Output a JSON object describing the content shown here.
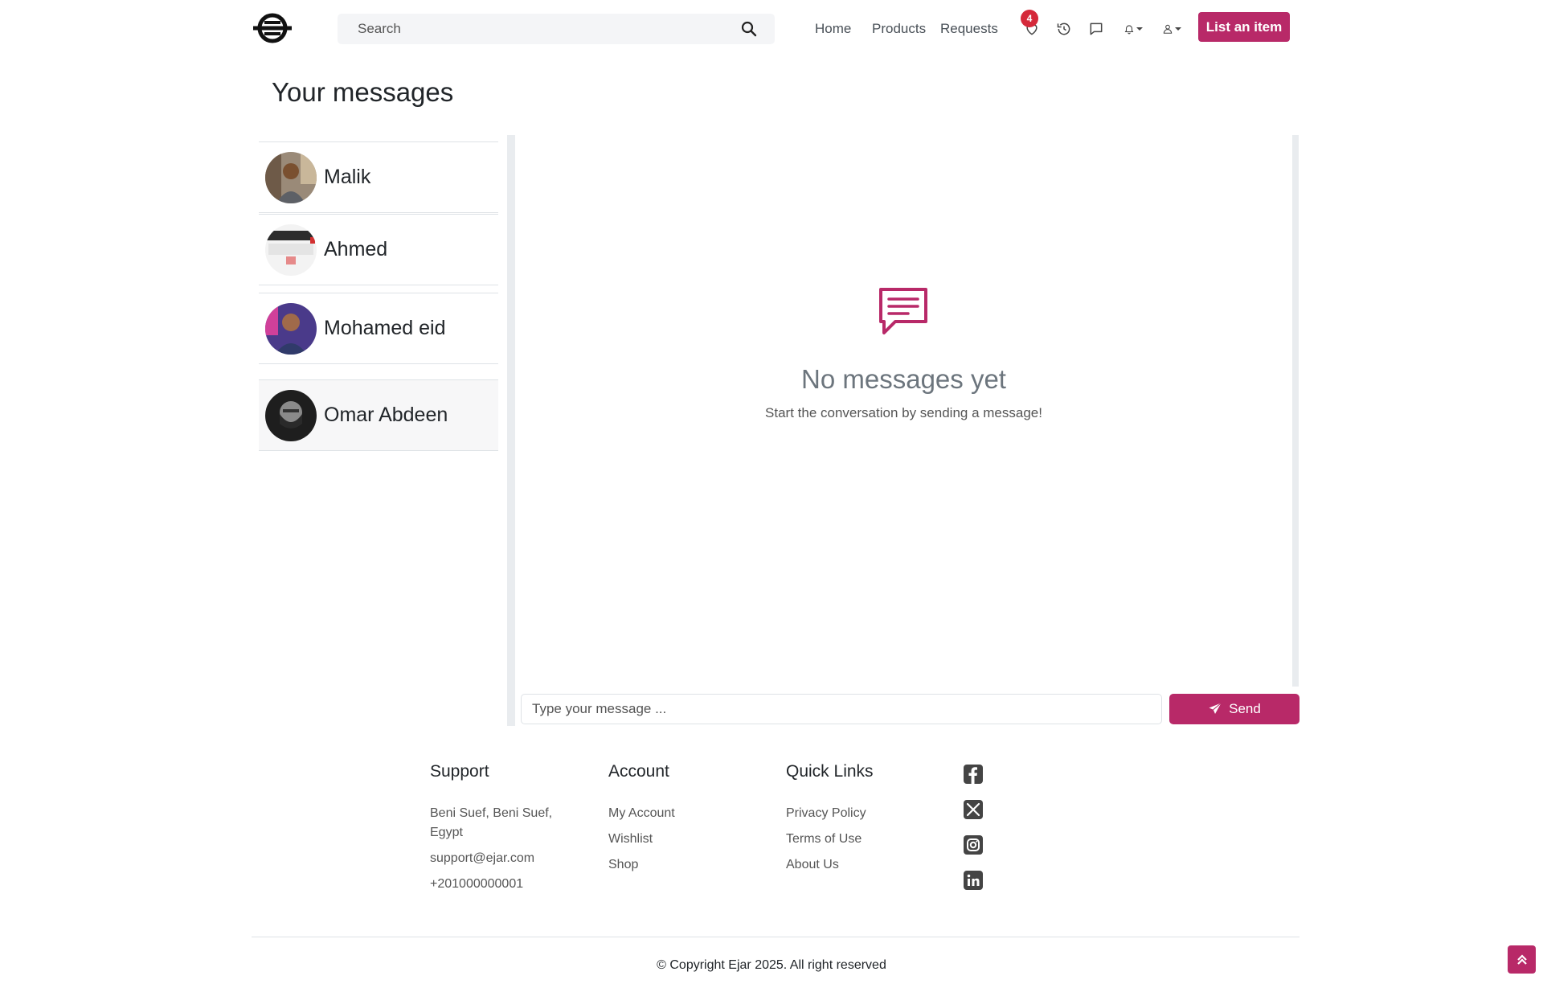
{
  "navbar": {
    "search_placeholder": "Search",
    "links": {
      "home": "Home",
      "products": "Products",
      "requests": "Requests"
    },
    "wishlist_count": "4",
    "list_item_label": "List an item"
  },
  "page": {
    "title": "Your messages"
  },
  "chats": [
    {
      "name": "Malik"
    },
    {
      "name": "Ahmed"
    },
    {
      "name": "Mohamed eid"
    },
    {
      "name": "Omar Abdeen"
    }
  ],
  "chat_panel": {
    "empty_title": "No messages yet",
    "empty_subtitle": "Start the conversation by sending a message!",
    "input_placeholder": "Type your message ...",
    "send_label": "Send"
  },
  "footer": {
    "support": {
      "heading": "Support",
      "address": "Beni Suef, Beni Suef, Egypt",
      "email": "support@ejar.com",
      "phone": "+201000000001"
    },
    "account": {
      "heading": "Account",
      "links": [
        "My Account",
        "Wishlist",
        "Shop"
      ]
    },
    "quick_links": {
      "heading": "Quick Links",
      "links": [
        "Privacy Policy",
        "Terms of Use",
        "About Us"
      ]
    },
    "social_icons": [
      "facebook-icon",
      "x-icon",
      "instagram-icon",
      "linkedin-icon"
    ],
    "copyright": "© Copyright Ejar 2025. All right reserved"
  },
  "colors": {
    "brand": "#b82968",
    "badge": "#d5293a",
    "muted": "#6c757d"
  }
}
